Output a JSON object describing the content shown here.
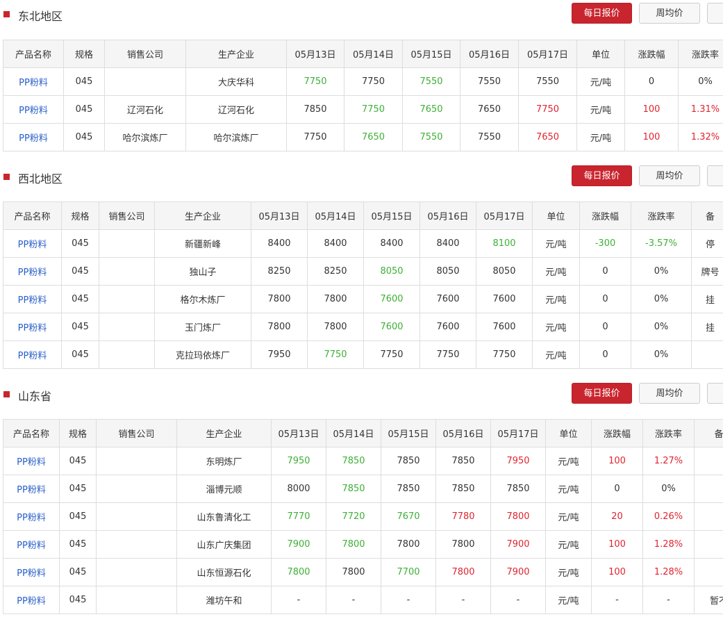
{
  "buttons": {
    "daily": "每日报价",
    "weekly": "周均价"
  },
  "headers": [
    "产品名称",
    "规格",
    "销售公司",
    "生产企业",
    "05月13日",
    "05月14日",
    "05月15日",
    "05月16日",
    "05月17日",
    "单位",
    "涨跌幅",
    "涨跌率",
    "备"
  ],
  "colors": {
    "up": "#e0232f",
    "down": "#3cb035",
    "flat": "#333333",
    "accent": "#c9252e",
    "link": "#2a5fc9"
  },
  "sections": [
    {
      "title": "东北地区",
      "rows": [
        {
          "product": "PP粉料",
          "spec": "045",
          "seller": "",
          "producer": "大庆华科",
          "prices": [
            {
              "v": "7750",
              "c": "g"
            },
            {
              "v": "7750",
              "c": "k"
            },
            {
              "v": "7550",
              "c": "g"
            },
            {
              "v": "7550",
              "c": "k"
            },
            {
              "v": "7550",
              "c": "k"
            }
          ],
          "unit": "元/吨",
          "change": {
            "v": "0",
            "c": "k"
          },
          "rate": {
            "v": "0%",
            "c": "k"
          },
          "note": ""
        },
        {
          "product": "PP粉料",
          "spec": "045",
          "seller": "辽河石化",
          "producer": "辽河石化",
          "prices": [
            {
              "v": "7850",
              "c": "k"
            },
            {
              "v": "7750",
              "c": "g"
            },
            {
              "v": "7650",
              "c": "g"
            },
            {
              "v": "7650",
              "c": "k"
            },
            {
              "v": "7750",
              "c": "r"
            }
          ],
          "unit": "元/吨",
          "change": {
            "v": "100",
            "c": "r"
          },
          "rate": {
            "v": "1.31%",
            "c": "r"
          },
          "note": ""
        },
        {
          "product": "PP粉料",
          "spec": "045",
          "seller": "哈尔滨炼厂",
          "producer": "哈尔滨炼厂",
          "prices": [
            {
              "v": "7750",
              "c": "k"
            },
            {
              "v": "7650",
              "c": "g"
            },
            {
              "v": "7550",
              "c": "g"
            },
            {
              "v": "7550",
              "c": "k"
            },
            {
              "v": "7650",
              "c": "r"
            }
          ],
          "unit": "元/吨",
          "change": {
            "v": "100",
            "c": "r"
          },
          "rate": {
            "v": "1.32%",
            "c": "r"
          },
          "note": ""
        }
      ]
    },
    {
      "title": "西北地区",
      "rows": [
        {
          "product": "PP粉料",
          "spec": "045",
          "seller": "",
          "producer": "新疆新峰",
          "prices": [
            {
              "v": "8400",
              "c": "k"
            },
            {
              "v": "8400",
              "c": "k"
            },
            {
              "v": "8400",
              "c": "k"
            },
            {
              "v": "8400",
              "c": "k"
            },
            {
              "v": "8100",
              "c": "g"
            }
          ],
          "unit": "元/吨",
          "change": {
            "v": "-300",
            "c": "g"
          },
          "rate": {
            "v": "-3.57%",
            "c": "g"
          },
          "note": "停"
        },
        {
          "product": "PP粉料",
          "spec": "045",
          "seller": "",
          "producer": "独山子",
          "prices": [
            {
              "v": "8250",
              "c": "k"
            },
            {
              "v": "8250",
              "c": "k"
            },
            {
              "v": "8050",
              "c": "g"
            },
            {
              "v": "8050",
              "c": "k"
            },
            {
              "v": "8050",
              "c": "k"
            }
          ],
          "unit": "元/吨",
          "change": {
            "v": "0",
            "c": "k"
          },
          "rate": {
            "v": "0%",
            "c": "k"
          },
          "note": "牌号"
        },
        {
          "product": "PP粉料",
          "spec": "045",
          "seller": "",
          "producer": "格尔木炼厂",
          "prices": [
            {
              "v": "7800",
              "c": "k"
            },
            {
              "v": "7800",
              "c": "k"
            },
            {
              "v": "7600",
              "c": "g"
            },
            {
              "v": "7600",
              "c": "k"
            },
            {
              "v": "7600",
              "c": "k"
            }
          ],
          "unit": "元/吨",
          "change": {
            "v": "0",
            "c": "k"
          },
          "rate": {
            "v": "0%",
            "c": "k"
          },
          "note": "挂"
        },
        {
          "product": "PP粉料",
          "spec": "045",
          "seller": "",
          "producer": "玉门炼厂",
          "prices": [
            {
              "v": "7800",
              "c": "k"
            },
            {
              "v": "7800",
              "c": "k"
            },
            {
              "v": "7600",
              "c": "g"
            },
            {
              "v": "7600",
              "c": "k"
            },
            {
              "v": "7600",
              "c": "k"
            }
          ],
          "unit": "元/吨",
          "change": {
            "v": "0",
            "c": "k"
          },
          "rate": {
            "v": "0%",
            "c": "k"
          },
          "note": "挂"
        },
        {
          "product": "PP粉料",
          "spec": "045",
          "seller": "",
          "producer": "克拉玛依炼厂",
          "prices": [
            {
              "v": "7950",
              "c": "k"
            },
            {
              "v": "7750",
              "c": "g"
            },
            {
              "v": "7750",
              "c": "k"
            },
            {
              "v": "7750",
              "c": "k"
            },
            {
              "v": "7750",
              "c": "k"
            }
          ],
          "unit": "元/吨",
          "change": {
            "v": "0",
            "c": "k"
          },
          "rate": {
            "v": "0%",
            "c": "k"
          },
          "note": ""
        }
      ]
    },
    {
      "title": "山东省",
      "rows": [
        {
          "product": "PP粉料",
          "spec": "045",
          "seller": "",
          "producer": "东明炼厂",
          "prices": [
            {
              "v": "7950",
              "c": "g"
            },
            {
              "v": "7850",
              "c": "g"
            },
            {
              "v": "7850",
              "c": "k"
            },
            {
              "v": "7850",
              "c": "k"
            },
            {
              "v": "7950",
              "c": "r"
            }
          ],
          "unit": "元/吨",
          "change": {
            "v": "100",
            "c": "r"
          },
          "rate": {
            "v": "1.27%",
            "c": "r"
          },
          "note": ""
        },
        {
          "product": "PP粉料",
          "spec": "045",
          "seller": "",
          "producer": "淄博元顺",
          "prices": [
            {
              "v": "8000",
              "c": "k"
            },
            {
              "v": "7850",
              "c": "g"
            },
            {
              "v": "7850",
              "c": "k"
            },
            {
              "v": "7850",
              "c": "k"
            },
            {
              "v": "7850",
              "c": "k"
            }
          ],
          "unit": "元/吨",
          "change": {
            "v": "0",
            "c": "k"
          },
          "rate": {
            "v": "0%",
            "c": "k"
          },
          "note": ""
        },
        {
          "product": "PP粉料",
          "spec": "045",
          "seller": "",
          "producer": "山东鲁清化工",
          "prices": [
            {
              "v": "7770",
              "c": "g"
            },
            {
              "v": "7720",
              "c": "g"
            },
            {
              "v": "7670",
              "c": "g"
            },
            {
              "v": "7780",
              "c": "r"
            },
            {
              "v": "7800",
              "c": "r"
            }
          ],
          "unit": "元/吨",
          "change": {
            "v": "20",
            "c": "r"
          },
          "rate": {
            "v": "0.26%",
            "c": "r"
          },
          "note": ""
        },
        {
          "product": "PP粉料",
          "spec": "045",
          "seller": "",
          "producer": "山东广庆集团",
          "prices": [
            {
              "v": "7900",
              "c": "g"
            },
            {
              "v": "7800",
              "c": "g"
            },
            {
              "v": "7800",
              "c": "k"
            },
            {
              "v": "7800",
              "c": "k"
            },
            {
              "v": "7900",
              "c": "r"
            }
          ],
          "unit": "元/吨",
          "change": {
            "v": "100",
            "c": "r"
          },
          "rate": {
            "v": "1.28%",
            "c": "r"
          },
          "note": ""
        },
        {
          "product": "PP粉料",
          "spec": "045",
          "seller": "",
          "producer": "山东恒源石化",
          "prices": [
            {
              "v": "7800",
              "c": "g"
            },
            {
              "v": "7800",
              "c": "k"
            },
            {
              "v": "7700",
              "c": "g"
            },
            {
              "v": "7800",
              "c": "r"
            },
            {
              "v": "7900",
              "c": "r"
            }
          ],
          "unit": "元/吨",
          "change": {
            "v": "100",
            "c": "r"
          },
          "rate": {
            "v": "1.28%",
            "c": "r"
          },
          "note": ""
        },
        {
          "product": "PP粉料",
          "spec": "045",
          "seller": "",
          "producer": "潍坊午和",
          "prices": [
            {
              "v": "-",
              "c": "k"
            },
            {
              "v": "-",
              "c": "k"
            },
            {
              "v": "-",
              "c": "k"
            },
            {
              "v": "-",
              "c": "k"
            },
            {
              "v": "-",
              "c": "k"
            }
          ],
          "unit": "元/吨",
          "change": {
            "v": "-",
            "c": "k"
          },
          "rate": {
            "v": "-",
            "c": "k"
          },
          "note": "暂不"
        }
      ]
    }
  ]
}
